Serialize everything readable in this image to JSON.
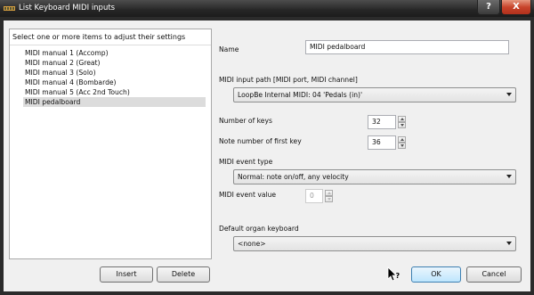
{
  "window": {
    "title": "List Keyboard MIDI inputs",
    "help_label": "?",
    "close_label": "X"
  },
  "list": {
    "header": "Select one or more items to adjust their settings",
    "items": [
      {
        "label": "MIDI manual 1 (Accomp)"
      },
      {
        "label": "MIDI manual 2 (Great)"
      },
      {
        "label": "MIDI manual 3 (Solo)"
      },
      {
        "label": "MIDI manual 4 (Bombarde)"
      },
      {
        "label": "MIDI manual 5 (Acc 2nd Touch)"
      },
      {
        "label": "MIDI pedalboard"
      }
    ],
    "selected_index": 5
  },
  "buttons": {
    "insert": "Insert",
    "delete": "Delete",
    "ok": "OK",
    "cancel": "Cancel"
  },
  "form": {
    "name_label": "Name",
    "name_value": "MIDI pedalboard",
    "input_path_label": "MIDI input path [MIDI port, MIDI channel]",
    "input_path_value": "LoopBe Internal MIDI: 04 'Pedals (in)'",
    "num_keys_label": "Number of keys",
    "num_keys_value": "32",
    "first_key_label": "Note number of first key",
    "first_key_value": "36",
    "event_type_label": "MIDI event type",
    "event_type_value": "Normal: note on/off, any velocity",
    "event_value_label": "MIDI event value",
    "event_value_value": "0",
    "default_kb_label": "Default organ keyboard",
    "default_kb_value": "<none>"
  }
}
